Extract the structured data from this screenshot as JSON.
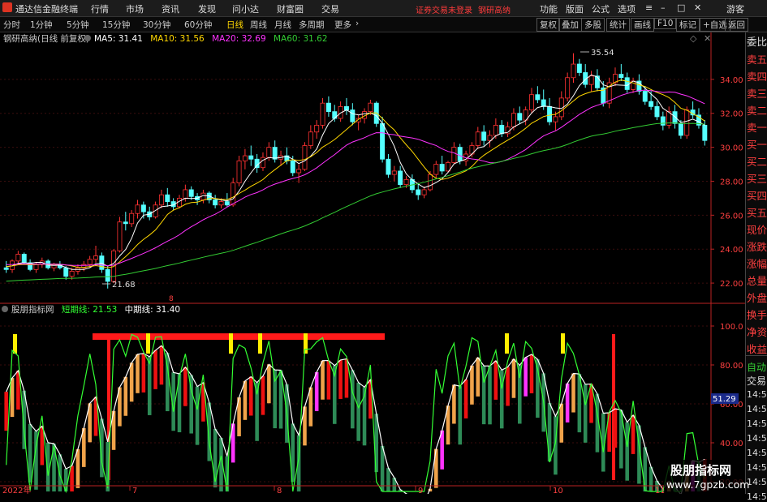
{
  "menubar": {
    "logo_icon": "app-logo-icon",
    "app_title": "通达信金融终端",
    "items": [
      "行情",
      "市场",
      "资讯",
      "发现",
      "问小达",
      "财富圈",
      "交易"
    ],
    "login_status": "证券交易未登录",
    "stock_name": "钢研高纳",
    "right_items": [
      "功能",
      "版面",
      "公式",
      "选项"
    ],
    "guest": "游客"
  },
  "toolbar": {
    "periods": [
      "分时",
      "1分钟",
      "5分钟",
      "15分钟",
      "30分钟",
      "60分钟",
      "日线",
      "周线",
      "月线",
      "多周期",
      "更多"
    ],
    "active_period": "日线",
    "buttons": [
      "复权",
      "叠加",
      "多股",
      "统计",
      "画线",
      "F10",
      "标记",
      "+自选",
      "返回"
    ]
  },
  "price_chart": {
    "title": "钢研高纳(日线 前复权)",
    "ma_legend": [
      {
        "label": "MA5: 31.41",
        "color": "#ffffff"
      },
      {
        "label": "MA10: 31.56",
        "color": "#ffd700"
      },
      {
        "label": "MA20: 32.69",
        "color": "#ff33ff"
      },
      {
        "label": "MA60: 31.62",
        "color": "#33cc33"
      }
    ],
    "y_ticks": [
      "34.00",
      "32.00",
      "30.00",
      "28.00",
      "26.00",
      "24.00",
      "22.00"
    ],
    "high_label": "35.54",
    "low_label": "21.68",
    "marker": "8"
  },
  "indicator": {
    "title": "股朋指标网",
    "short_line": "短期线: 21.53",
    "mid_line": "中期线: 31.40",
    "y_ticks": [
      "100.0",
      "80.00",
      "60.00",
      "40.00",
      "20.00"
    ],
    "current_value": "51.29"
  },
  "x_axis": [
    "2022年",
    "7",
    "8",
    "9",
    "10",
    "11"
  ],
  "sidebar": {
    "top_label": "委比",
    "items": [
      "卖五",
      "卖四",
      "卖三",
      "卖二",
      "卖一",
      "买一",
      "买二",
      "买三",
      "买四",
      "买五",
      "现价",
      "涨跌",
      "涨幅",
      "总量",
      "外盘",
      "换手",
      "净资",
      "收益"
    ],
    "bottom_items": [
      "自动",
      "交易",
      "14:56",
      "14:56",
      "14:56",
      "14:56",
      "14:56",
      "14:56",
      "14:56",
      "14:56"
    ]
  },
  "watermark": {
    "title": "股朋指标网",
    "url": "www.7gpzb.com"
  },
  "chart_data": {
    "type": "candlestick",
    "candles": [
      [
        22.9,
        23.3,
        22.6,
        22.8
      ],
      [
        22.8,
        23.4,
        22.6,
        23.3
      ],
      [
        23.3,
        23.9,
        23.1,
        23.7
      ],
      [
        23.7,
        23.8,
        23.1,
        23.2
      ],
      [
        23.2,
        23.4,
        22.7,
        22.8
      ],
      [
        22.8,
        23.2,
        22.6,
        23.1
      ],
      [
        23.1,
        23.5,
        22.9,
        23.3
      ],
      [
        23.3,
        23.4,
        22.8,
        22.9
      ],
      [
        22.9,
        23.2,
        22.7,
        23.1
      ],
      [
        23.1,
        23.3,
        22.8,
        22.9
      ],
      [
        22.9,
        23.0,
        22.2,
        22.4
      ],
      [
        22.4,
        22.9,
        22.2,
        22.7
      ],
      [
        22.7,
        23.1,
        22.5,
        22.9
      ],
      [
        22.9,
        23.3,
        22.7,
        23.1
      ],
      [
        23.1,
        23.6,
        22.9,
        23.4
      ],
      [
        23.4,
        24.2,
        23.2,
        23.6
      ],
      [
        23.6,
        23.8,
        22.6,
        22.8
      ],
      [
        22.8,
        23.0,
        21.68,
        22.1
      ],
      [
        22.1,
        24.0,
        22.0,
        23.9
      ],
      [
        23.9,
        25.9,
        23.8,
        25.6
      ],
      [
        25.6,
        26.2,
        25.1,
        25.5
      ],
      [
        25.5,
        26.3,
        25.3,
        26.1
      ],
      [
        26.1,
        26.9,
        25.8,
        26.6
      ],
      [
        26.6,
        26.8,
        25.8,
        26.2
      ],
      [
        26.2,
        26.5,
        25.7,
        25.9
      ],
      [
        25.9,
        26.8,
        25.8,
        26.6
      ],
      [
        26.6,
        27.5,
        26.4,
        27.2
      ],
      [
        27.2,
        27.6,
        26.5,
        26.8
      ],
      [
        26.8,
        27.0,
        26.3,
        26.5
      ],
      [
        26.5,
        27.2,
        26.4,
        27.0
      ],
      [
        27.0,
        27.8,
        26.8,
        27.5
      ],
      [
        27.5,
        27.7,
        26.9,
        27.1
      ],
      [
        27.1,
        27.3,
        26.6,
        26.9
      ],
      [
        26.9,
        27.5,
        26.7,
        27.3
      ],
      [
        27.3,
        27.4,
        26.7,
        26.9
      ],
      [
        26.9,
        27.2,
        26.4,
        26.6
      ],
      [
        26.6,
        27.0,
        26.4,
        26.8
      ],
      [
        26.8,
        27.3,
        26.5,
        26.6
      ],
      [
        26.6,
        28.2,
        26.5,
        27.9
      ],
      [
        27.9,
        29.5,
        27.7,
        29.2
      ],
      [
        29.2,
        29.9,
        28.7,
        29.5
      ],
      [
        29.5,
        30.1,
        28.9,
        29.3
      ],
      [
        29.3,
        29.6,
        28.5,
        28.8
      ],
      [
        28.8,
        29.7,
        28.6,
        29.4
      ],
      [
        29.4,
        30.3,
        29.2,
        30.0
      ],
      [
        30.0,
        30.4,
        29.1,
        29.3
      ],
      [
        29.3,
        29.8,
        28.9,
        29.5
      ],
      [
        29.5,
        30.0,
        29.0,
        29.2
      ],
      [
        29.2,
        29.5,
        28.3,
        28.5
      ],
      [
        28.5,
        29.0,
        27.9,
        28.7
      ],
      [
        28.7,
        30.3,
        28.6,
        30.1
      ],
      [
        30.1,
        31.3,
        29.9,
        30.9
      ],
      [
        30.9,
        31.6,
        30.5,
        31.3
      ],
      [
        31.3,
        32.9,
        31.1,
        32.6
      ],
      [
        32.6,
        33.0,
        31.8,
        32.1
      ],
      [
        32.1,
        32.5,
        31.5,
        31.7
      ],
      [
        31.7,
        32.7,
        31.5,
        32.4
      ],
      [
        32.4,
        32.9,
        31.9,
        32.2
      ],
      [
        32.2,
        32.6,
        31.3,
        31.5
      ],
      [
        31.5,
        31.9,
        31.0,
        31.7
      ],
      [
        31.7,
        32.3,
        31.4,
        32.1
      ],
      [
        32.1,
        32.8,
        31.9,
        32.6
      ],
      [
        32.6,
        32.7,
        31.2,
        31.4
      ],
      [
        31.4,
        31.8,
        29.1,
        29.3
      ],
      [
        29.3,
        29.6,
        28.2,
        28.4
      ],
      [
        28.4,
        28.9,
        28.0,
        28.6
      ],
      [
        28.6,
        28.9,
        27.6,
        27.8
      ],
      [
        27.8,
        28.3,
        27.6,
        28.1
      ],
      [
        28.1,
        28.4,
        27.3,
        27.5
      ],
      [
        27.5,
        27.9,
        26.9,
        27.2
      ],
      [
        27.2,
        27.7,
        27.0,
        27.5
      ],
      [
        27.5,
        28.6,
        27.4,
        28.4
      ],
      [
        28.4,
        29.2,
        28.2,
        29.0
      ],
      [
        29.0,
        29.5,
        28.4,
        28.6
      ],
      [
        28.6,
        29.2,
        28.5,
        29.1
      ],
      [
        29.1,
        30.3,
        29.0,
        30.0
      ],
      [
        30.0,
        30.2,
        29.0,
        29.2
      ],
      [
        29.2,
        29.8,
        28.9,
        29.6
      ],
      [
        29.6,
        30.3,
        29.4,
        30.1
      ],
      [
        30.1,
        31.2,
        29.9,
        30.9
      ],
      [
        30.9,
        31.3,
        30.1,
        30.4
      ],
      [
        30.4,
        31.0,
        30.0,
        30.7
      ],
      [
        30.7,
        31.7,
        30.5,
        31.3
      ],
      [
        31.3,
        31.6,
        30.6,
        30.8
      ],
      [
        30.8,
        31.5,
        30.6,
        31.2
      ],
      [
        31.2,
        32.3,
        31.0,
        32.0
      ],
      [
        32.0,
        32.4,
        31.4,
        31.6
      ],
      [
        31.6,
        32.4,
        31.3,
        32.2
      ],
      [
        32.2,
        33.5,
        32.0,
        33.1
      ],
      [
        33.1,
        33.6,
        32.6,
        32.8
      ],
      [
        32.8,
        33.4,
        32.2,
        32.4
      ],
      [
        32.4,
        32.9,
        31.3,
        31.5
      ],
      [
        31.5,
        32.1,
        31.0,
        31.8
      ],
      [
        31.8,
        33.3,
        31.6,
        32.9
      ],
      [
        32.9,
        34.4,
        32.7,
        34.1
      ],
      [
        34.1,
        35.54,
        33.8,
        34.9
      ],
      [
        34.9,
        35.2,
        34.2,
        34.4
      ],
      [
        34.4,
        34.9,
        33.5,
        33.7
      ],
      [
        33.7,
        34.5,
        33.3,
        34.2
      ],
      [
        34.2,
        34.6,
        33.3,
        33.5
      ],
      [
        33.5,
        33.9,
        32.4,
        32.6
      ],
      [
        32.6,
        34.1,
        32.3,
        33.8
      ],
      [
        33.8,
        34.7,
        33.6,
        34.3
      ],
      [
        34.3,
        34.9,
        33.9,
        34.1
      ],
      [
        34.1,
        34.4,
        33.2,
        33.4
      ],
      [
        33.4,
        34.1,
        33.2,
        33.9
      ],
      [
        33.9,
        34.3,
        33.1,
        33.3
      ],
      [
        33.3,
        33.6,
        32.5,
        32.7
      ],
      [
        32.7,
        33.3,
        32.2,
        32.4
      ],
      [
        32.4,
        32.7,
        31.6,
        31.8
      ],
      [
        31.8,
        32.1,
        31.0,
        31.3
      ],
      [
        31.3,
        32.4,
        31.1,
        32.1
      ],
      [
        32.1,
        32.5,
        31.1,
        31.4
      ],
      [
        31.4,
        31.6,
        30.5,
        30.7
      ],
      [
        30.7,
        32.4,
        30.5,
        32.2
      ],
      [
        32.2,
        32.7,
        31.7,
        31.9
      ],
      [
        31.9,
        32.3,
        31.1,
        31.3
      ],
      [
        31.3,
        31.6,
        30.1,
        30.4
      ]
    ],
    "ma": {
      "MA5": 31.41,
      "MA10": 31.56,
      "MA20": 32.69,
      "MA60": 31.62
    },
    "y_range": [
      21.0,
      36.0
    ],
    "indicator_range": [
      15,
      105
    ],
    "short_line_last": 21.53,
    "mid_line_last": 31.4
  }
}
